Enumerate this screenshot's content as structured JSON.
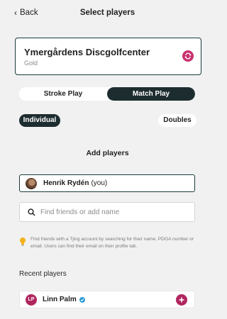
{
  "header": {
    "back_label": "Back",
    "title": "Select players"
  },
  "course": {
    "name": "Ymergårdens Discgolfcenter",
    "layout": "Gold"
  },
  "game_mode": {
    "options": [
      "Stroke Play",
      "Match Play"
    ],
    "selected": "Match Play"
  },
  "team_mode": {
    "options": [
      "Individual",
      "Doubles"
    ],
    "selected": "Individual"
  },
  "add_players": {
    "title": "Add players",
    "current_player": {
      "name": "Henrik Rydén",
      "suffix": "(you)"
    }
  },
  "search": {
    "placeholder": "Find friends or add name",
    "value": ""
  },
  "hint": {
    "text": "Find friends with a Tjing account by searching for their name, PDGA number or email. Users can find their email on their profile tab."
  },
  "recent": {
    "title": "Recent players",
    "players": [
      {
        "initials": "LP",
        "name": "Linn Palm",
        "verified": true
      }
    ]
  },
  "colors": {
    "accent": "#c8306f",
    "dark": "#1d2c2f",
    "background": "#f2f1f2",
    "verified": "#2b9bd4",
    "hint_bulb": "#f2b21b"
  },
  "icons": {
    "back": "chevron-left-icon",
    "swap": "swap-icon",
    "search": "search-icon",
    "hint": "lightbulb-icon",
    "add": "plus-icon"
  }
}
